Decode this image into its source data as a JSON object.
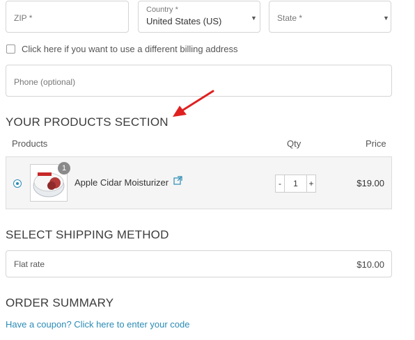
{
  "address": {
    "zip_placeholder": "ZIP *",
    "country_label": "Country *",
    "country_value": "United States (US)",
    "state_placeholder": "State *",
    "billing_checkbox_label": "Click here if you want to use a different billing address",
    "phone_placeholder": "Phone (optional)"
  },
  "products": {
    "title": "YOUR PRODUCTS SECTION",
    "col_products": "Products",
    "col_qty": "Qty",
    "col_price": "Price",
    "item": {
      "name": "Apple Cidar Moisturizer",
      "badge": "1",
      "qty_minus": "-",
      "qty_value": "1",
      "qty_plus": "+",
      "price": "$19.00",
      "thumb_text": "apple cider"
    }
  },
  "shipping": {
    "title": "SELECT SHIPPING METHOD",
    "method": "Flat rate",
    "price": "$10.00"
  },
  "summary": {
    "title": "ORDER SUMMARY",
    "coupon_link": "Have a coupon? Click here to enter your code"
  },
  "colors": {
    "arrow": "#e02020",
    "link": "#2a8bb5",
    "radio": "#2a8bb5"
  }
}
